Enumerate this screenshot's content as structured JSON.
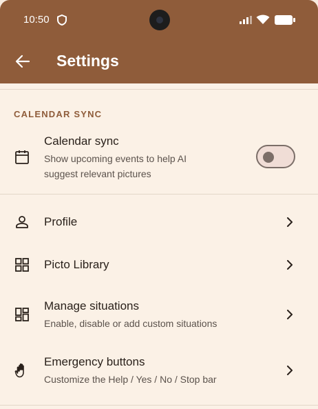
{
  "status_bar": {
    "time": "10:50",
    "shield_icon": "shield-icon",
    "signal_icon": "signal-icon",
    "wifi_icon": "wifi-icon",
    "battery_icon": "battery-icon"
  },
  "app_bar": {
    "title": "Settings",
    "back_icon": "arrow-left-icon",
    "color": "#8f5c3a"
  },
  "calendar_section": {
    "header": "CALENDAR SYNC",
    "item": {
      "title": "Calendar sync",
      "subtitle_line1": "Show upcoming events to help AI",
      "subtitle_line2": "suggest relevant pictures",
      "icon": "calendar-icon",
      "toggle_on": false
    }
  },
  "items": [
    {
      "title": "Profile",
      "subtitle": "",
      "icon": "person-icon"
    },
    {
      "title": "Picto Library",
      "subtitle": "",
      "icon": "grid-icon"
    },
    {
      "title": "Manage situations",
      "subtitle": "Enable, disable or add custom situations",
      "icon": "dashboard-icon"
    },
    {
      "title": "Emergency buttons",
      "subtitle": "Customize the Help / Yes / No / Stop bar",
      "icon": "hand-icon"
    }
  ],
  "colors": {
    "background": "#fbf1e6",
    "accent": "#8f5c3a",
    "text": "#2a211b",
    "secondary_text": "#5b524c"
  }
}
